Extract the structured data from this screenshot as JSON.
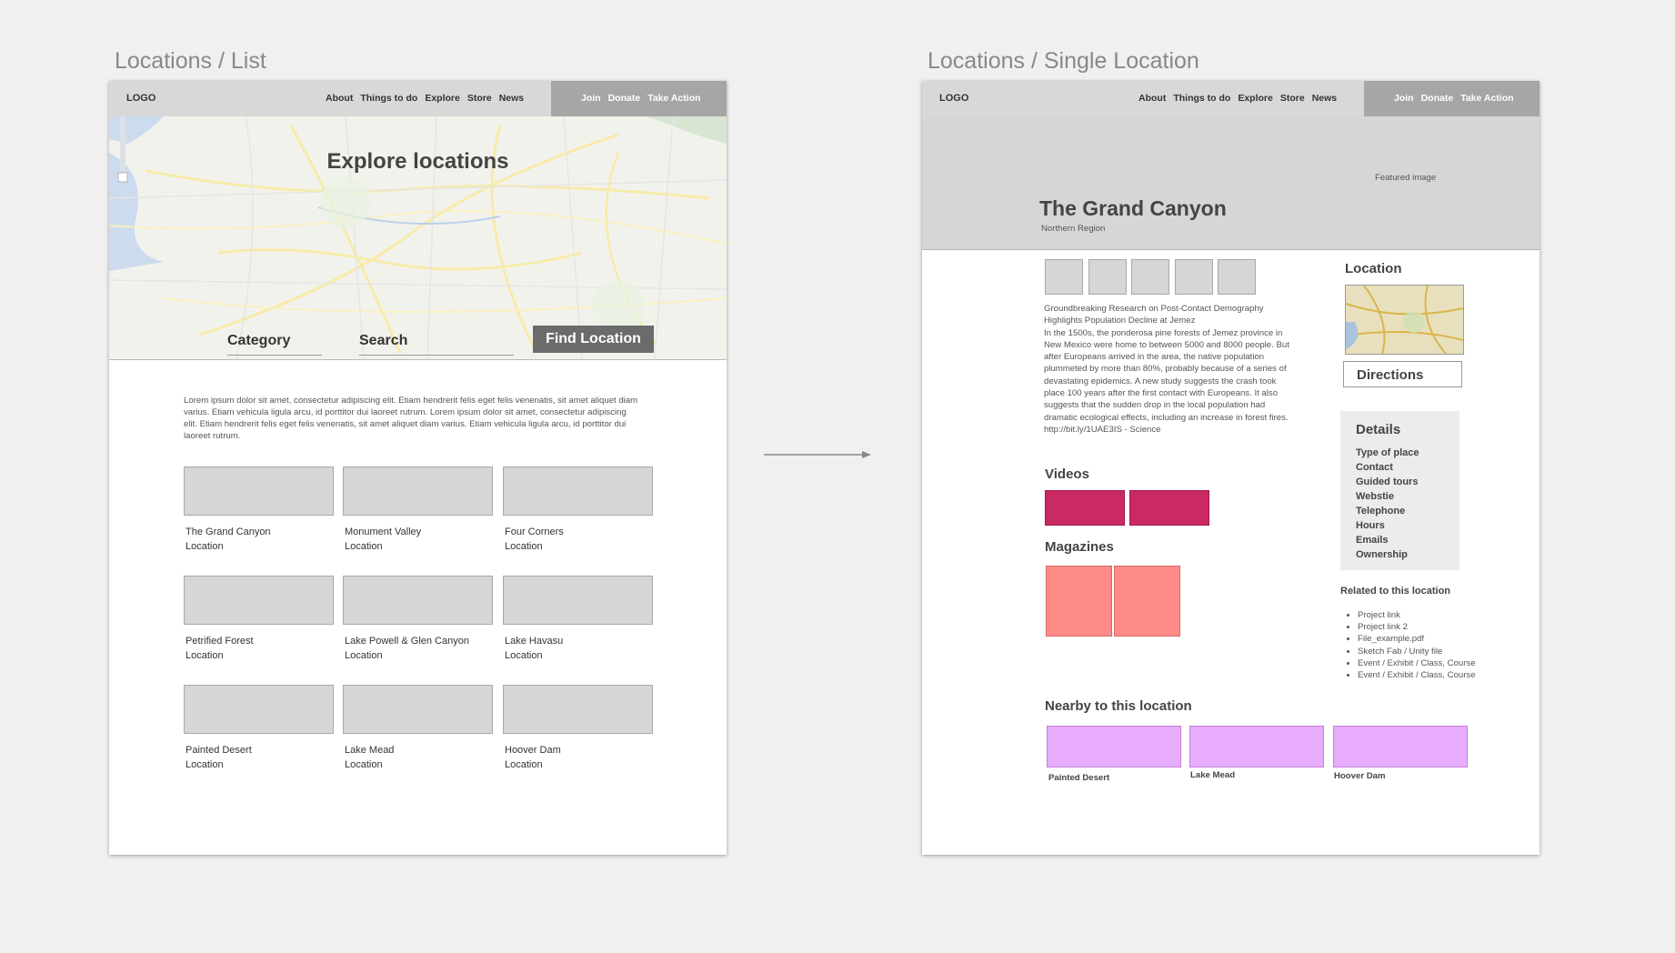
{
  "boards": {
    "list_title": "Locations / List",
    "single_title": "Locations / Single Location"
  },
  "header": {
    "logo": "LOGO",
    "nav": [
      "About",
      "Things to do",
      "Explore",
      "Store",
      "News"
    ],
    "actions": [
      "Join",
      "Donate",
      "Take Action"
    ]
  },
  "list": {
    "hero_title": "Explore locations",
    "category_label": "Category",
    "search_label": "Search",
    "find_button": "Find Location",
    "intro": "Lorem ipsum dolor sit amet, consectetur adipiscing elit. Etiam hendrerit felis eget felis venenatis, sit amet aliquet diam varius. Etiam vehicula ligula arcu, id porttitor dui laoreet rutrum. Lorem ipsum dolor sit amet, consectetur adipiscing elit. Etiam hendrerit felis eget felis venenatis, sit amet aliquet diam varius. Etiam vehicula ligula arcu, id porttitor dui laoreet rutrum.",
    "cards": [
      {
        "name": "The Grand Canyon",
        "type": "Location"
      },
      {
        "name": "Monument Valley",
        "type": "Location"
      },
      {
        "name": "Four Corners",
        "type": "Location"
      },
      {
        "name": "Petrified Forest",
        "type": "Location"
      },
      {
        "name": "Lake Powell & Glen Canyon",
        "type": "Location"
      },
      {
        "name": "Lake Havasu",
        "type": "Location"
      },
      {
        "name": "Painted Desert",
        "type": "Location"
      },
      {
        "name": "Lake Mead",
        "type": "Location"
      },
      {
        "name": "Hoover Dam",
        "type": "Location"
      }
    ]
  },
  "single": {
    "featured_label": "Featured image",
    "title": "The Grand Canyon",
    "region": "Northern Region",
    "article_headline": "Groundbreaking Research on Post-Contact Demography Highlights Population Decline at Jemez",
    "article_body": "In the 1500s, the ponderosa pine forests of Jemez province in New Mexico were home to between 5000 and 8000 people. But after Europeans arrived in the area, the native population plummeted by more than 80%, probably because of a series of devastating epidemics. A new study suggests the crash took place 100 years after the first contact with Europeans. It also suggests that the sudden drop in the local population had dramatic ecological effects, including an increase in forest fires. http://bit.ly/1UAE3IS - Science",
    "videos_title": "Videos",
    "magazines_title": "Magazines",
    "nearby_title": "Nearby to this location",
    "nearby": [
      "Painted Desert",
      "Lake Mead",
      "Hoover Dam"
    ],
    "location_title": "Location",
    "directions_button": "Directions",
    "details_title": "Details",
    "details": [
      "Type of place",
      "Contact",
      "Guided tours",
      "Webstie",
      "Telephone",
      "Hours",
      "Emails",
      "Ownership"
    ],
    "related_title": "Related to this location",
    "related": [
      "Project link",
      "Project link 2",
      "File_example.pdf",
      "Sketch Fab / Unity file",
      "Event / Exhibit / Class, Course",
      "Event / Exhibit / Class, Course"
    ]
  },
  "colors": {
    "video": "#c92a64",
    "magazine": "#fe8b88",
    "nearby": "#e8acfc",
    "find_button": "#6b6b6b"
  }
}
